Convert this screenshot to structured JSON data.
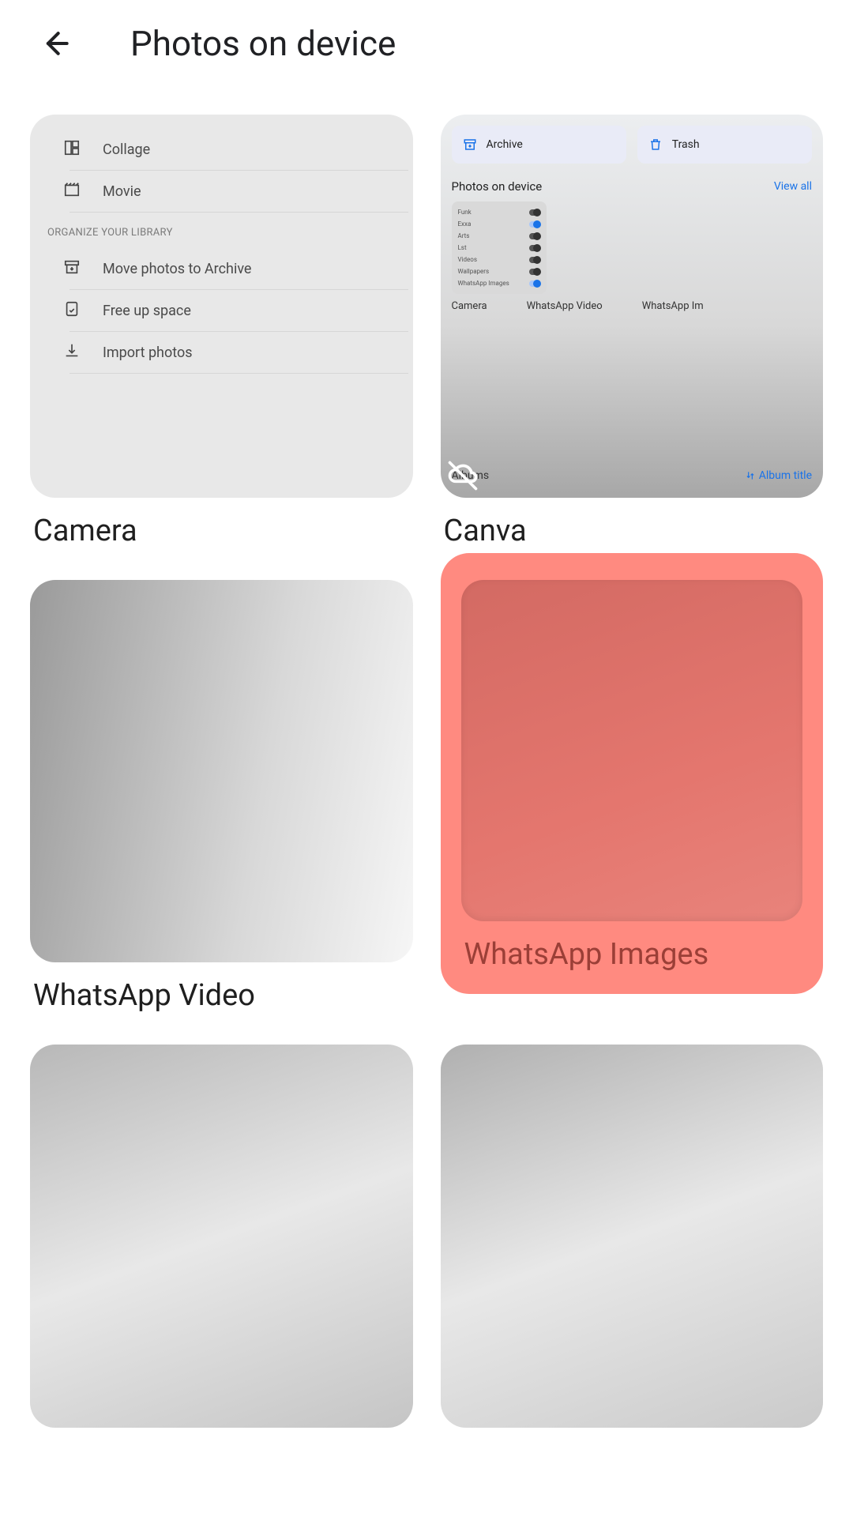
{
  "header": {
    "title": "Photos on device",
    "back_icon": "arrow-back"
  },
  "folders": [
    {
      "label": "Camera",
      "thumb_type": "menu",
      "cloud_off": false
    },
    {
      "label": "Canva",
      "thumb_type": "library",
      "cloud_off": true
    },
    {
      "label": "WhatsApp Video",
      "thumb_type": "gradient",
      "cloud_off": false
    },
    {
      "label": "WhatsApp Images",
      "thumb_type": "gradient",
      "highlighted": true,
      "cloud_off": false
    },
    {
      "label": "",
      "thumb_type": "gradient",
      "cloud_off": false
    },
    {
      "label": "",
      "thumb_type": "gradient",
      "cloud_off": false
    }
  ],
  "camera_thumb_menu": {
    "items_top": [
      {
        "icon": "collage",
        "label": "Collage"
      },
      {
        "icon": "movie",
        "label": "Movie"
      }
    ],
    "section_title": "ORGANIZE YOUR LIBRARY",
    "items_bottom": [
      {
        "icon": "archive",
        "label": "Move photos to Archive"
      },
      {
        "icon": "free-up",
        "label": "Free up space"
      },
      {
        "icon": "import",
        "label": "Import photos"
      }
    ]
  },
  "canva_thumb": {
    "chips": [
      {
        "icon": "archive",
        "label": "Archive",
        "color": "#1a73e8"
      },
      {
        "icon": "trash",
        "label": "Trash",
        "color": "#1a73e8"
      }
    ],
    "section": "Photos on device",
    "link": "View all",
    "toggles": [
      {
        "label": "Funk",
        "on": false
      },
      {
        "label": "Exxa",
        "on": true
      },
      {
        "label": "Arts",
        "on": false
      },
      {
        "label": "Lst",
        "on": false
      },
      {
        "label": "Videos",
        "on": false
      },
      {
        "label": "Wallpapers",
        "on": false
      },
      {
        "label": "WhatsApp Images",
        "on": true
      }
    ],
    "strip_labels": [
      "Camera",
      "WhatsApp Video",
      "WhatsApp Im"
    ],
    "albums_label": "Albums",
    "sort_label": "Album title"
  }
}
